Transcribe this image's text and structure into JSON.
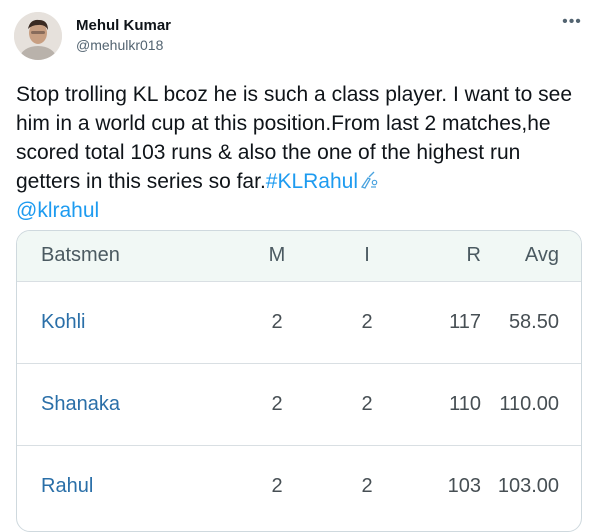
{
  "tweet": {
    "author": {
      "display_name": "Mehul Kumar",
      "handle": "@mehulkr018",
      "avatar_icon": "avatar-photo"
    },
    "more_icon": "more-options-icon",
    "text_before_links": "Stop trolling KL bcoz he is such a class player. I want to see him in a world cup at this position.From last 2 matches,he scored total 103 runs & also the one of the highest run getters in this series so far.",
    "hashtag": "#KLRahul",
    "mention": "@klrahul",
    "emoji_icon": "cricket-emoji-icon"
  },
  "stats_table": {
    "headers": [
      "Batsmen",
      "M",
      "I",
      "R",
      "Avg"
    ],
    "rows": [
      {
        "name": "Kohli",
        "m": "2",
        "i": "2",
        "r": "117",
        "avg": "58.50"
      },
      {
        "name": "Shanaka",
        "m": "2",
        "i": "2",
        "r": "110",
        "avg": "110.00"
      },
      {
        "name": "Rahul",
        "m": "2",
        "i": "2",
        "r": "103",
        "avg": "103.00"
      }
    ]
  },
  "colors": {
    "link": "#1d9bf0",
    "player_name": "#2a6fa8",
    "header_bg": "#f1f8f5",
    "border": "#cfd9de"
  }
}
